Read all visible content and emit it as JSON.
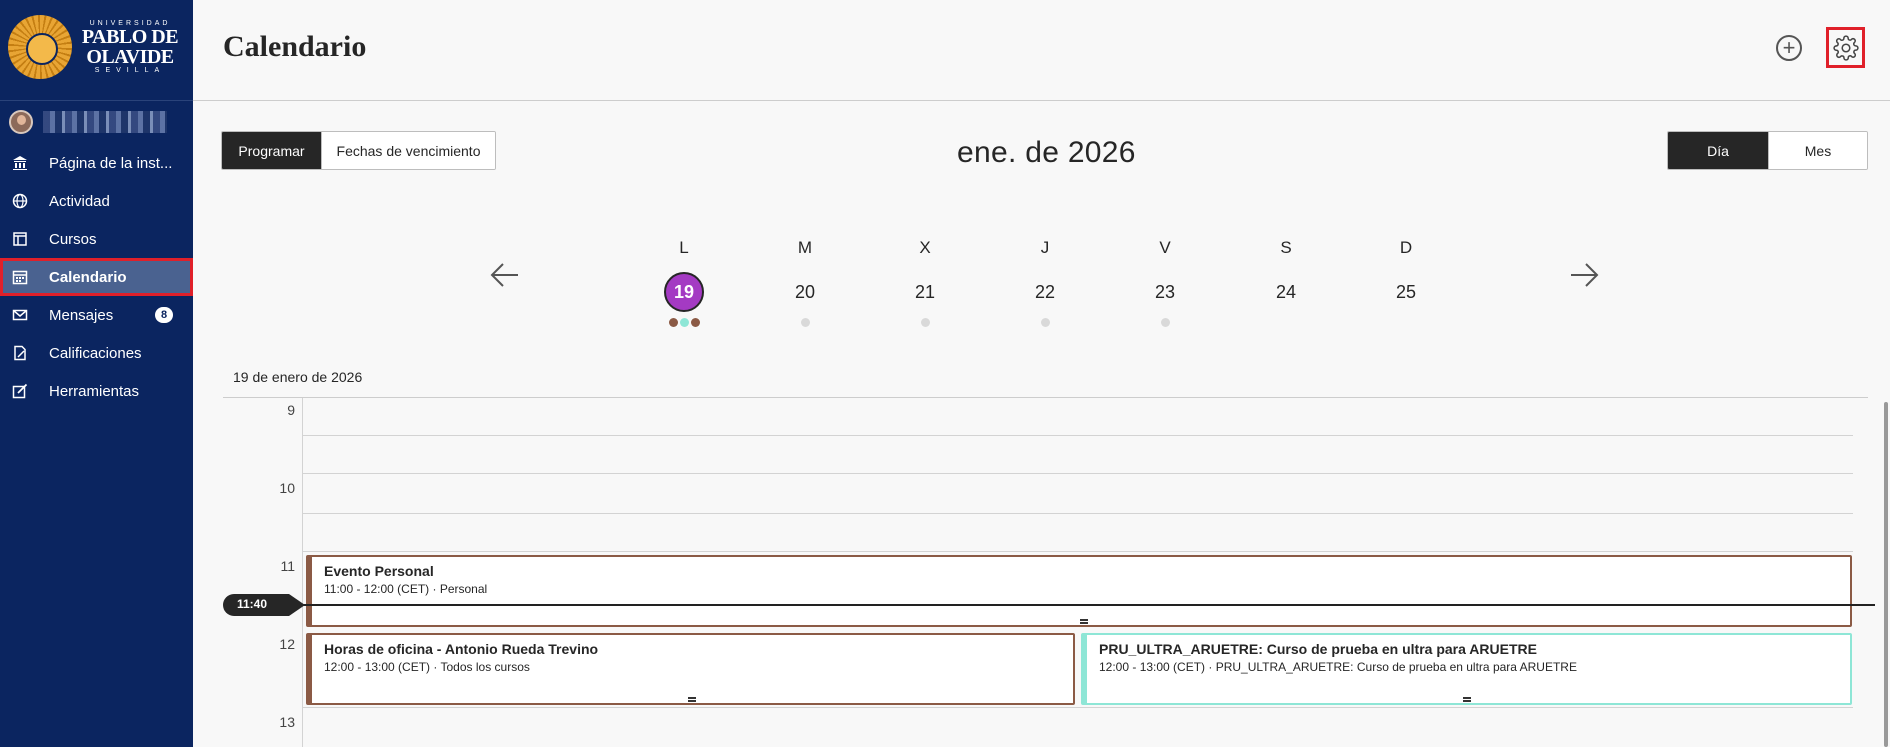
{
  "sidebar": {
    "logo": {
      "top": "UNIVERSIDAD",
      "main": "PABLO DE OLAVIDE",
      "bottom": "SEVILLA"
    },
    "items": [
      {
        "label": "Página de la inst...",
        "icon": "institution-icon"
      },
      {
        "label": "Actividad",
        "icon": "globe-icon"
      },
      {
        "label": "Cursos",
        "icon": "courses-icon"
      },
      {
        "label": "Calendario",
        "icon": "calendar-icon",
        "active": true
      },
      {
        "label": "Mensajes",
        "icon": "mail-icon",
        "badge": "8"
      },
      {
        "label": "Calificaciones",
        "icon": "grades-icon"
      },
      {
        "label": "Herramientas",
        "icon": "tools-icon"
      }
    ]
  },
  "header": {
    "title": "Calendario"
  },
  "toolbar": {
    "view_left": [
      "Programar",
      "Fechas de vencimiento"
    ],
    "month": "ene. de 2026",
    "view_right": [
      "Día",
      "Mes"
    ]
  },
  "week": [
    {
      "letter": "L",
      "num": "19",
      "today": true
    },
    {
      "letter": "M",
      "num": "20"
    },
    {
      "letter": "X",
      "num": "21"
    },
    {
      "letter": "J",
      "num": "22"
    },
    {
      "letter": "V",
      "num": "23"
    },
    {
      "letter": "S",
      "num": "24"
    },
    {
      "letter": "D",
      "num": "25"
    }
  ],
  "colors": {
    "personal": "#8b5a45",
    "course": "#8ee6d6",
    "today": "#a43ac3",
    "sidebar": "#0b2560"
  },
  "selected_date": "19 de enero de 2026",
  "hours": [
    "9",
    "10",
    "11",
    "12",
    "13"
  ],
  "now": "11:40",
  "events": [
    {
      "title": "Evento Personal",
      "sub": "11:00 - 12:00 (CET) · Personal"
    },
    {
      "title": "Horas de oficina - Antonio Rueda Trevino",
      "sub": "12:00 - 13:00 (CET) · Todos los cursos"
    },
    {
      "title": "PRU_ULTRA_ARUETRE: Curso de prueba en ultra para ARUETRE",
      "sub": "12:00 - 13:00 (CET) ·  PRU_ULTRA_ARUETRE: Curso de prueba en ultra para ARUETRE"
    }
  ]
}
